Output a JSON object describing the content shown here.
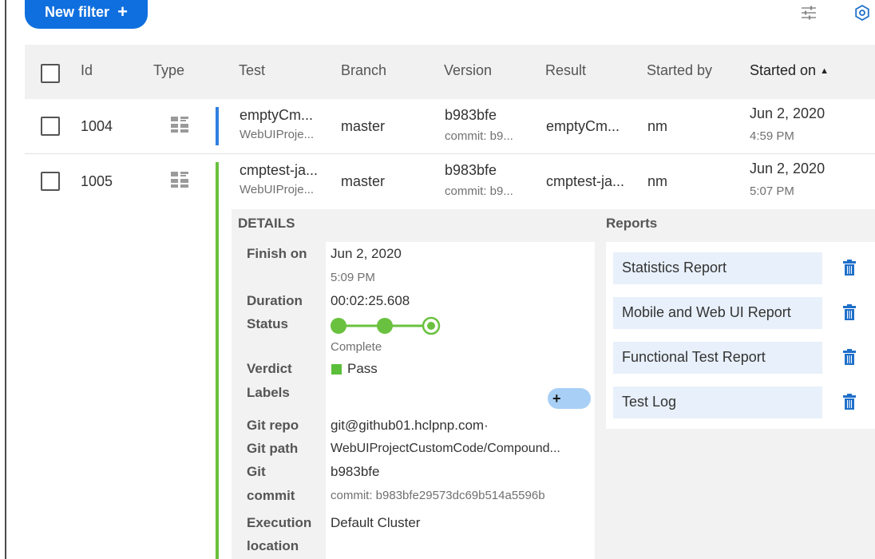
{
  "toolbar": {
    "new_filter_label": "New filter",
    "new_filter_plus": "+",
    "icons": [
      "filter-settings-icon",
      "gear-icon"
    ]
  },
  "table": {
    "columns": [
      "Id",
      "Type",
      "Test",
      "Branch",
      "Version",
      "Result",
      "Started by",
      "Started on"
    ],
    "sort_indicator": "▲",
    "rows": [
      {
        "id": "1004",
        "test": "emptyCm...",
        "test_project": "WebUIProje...",
        "branch": "master",
        "version": "b983bfe",
        "version_commit": "commit: b9...",
        "result": "emptyCm...",
        "started_by": "nm",
        "started_date": "Jun 2, 2020",
        "started_time": "4:59 PM",
        "stripe_color": "#2f7fe0"
      },
      {
        "id": "1005",
        "test": "cmptest-ja...",
        "test_project": "WebUIProje...",
        "branch": "master",
        "version": "b983bfe",
        "version_commit": "commit: b9...",
        "result": "cmptest-ja...",
        "started_by": "nm",
        "started_date": "Jun 2, 2020",
        "started_time": "5:07 PM",
        "stripe_color": "#6ac13f"
      }
    ]
  },
  "details": {
    "title": "DETAILS",
    "finish_on_label": "Finish on",
    "finish_on_date": "Jun 2, 2020",
    "finish_on_time": "5:09 PM",
    "duration_label": "Duration",
    "duration_value": "00:02:25.608",
    "status_label": "Status",
    "status_value": "Complete",
    "status_steps_completed": 3,
    "verdict_label": "Verdict",
    "verdict_value": "Pass",
    "verdict_color": "#5cbf3a",
    "labels_label": "Labels",
    "add_label_plus": "+",
    "git_repo_label": "Git repo",
    "git_repo_value": "git@github01.hclpnp.com·",
    "git_path_label": "Git path",
    "git_path_value": "WebUIProjectCustomCode/Compound...",
    "git_commit_label_1": "Git",
    "git_commit_label_2": "commit",
    "git_commit_value": "b983bfe",
    "git_commit_full": "commit: b983bfe29573dc69b514a5596b",
    "execution_label_1": "Execution",
    "execution_label_2": "location",
    "execution_value": "Default Cluster"
  },
  "reports": {
    "title": "Reports",
    "items": [
      "Statistics Report",
      "Mobile and Web UI Report",
      "Functional Test Report",
      "Test Log"
    ]
  },
  "colors": {
    "accent_blue": "#0f6fde",
    "status_green": "#6ac13f",
    "trash_blue": "#1f6fc9"
  }
}
